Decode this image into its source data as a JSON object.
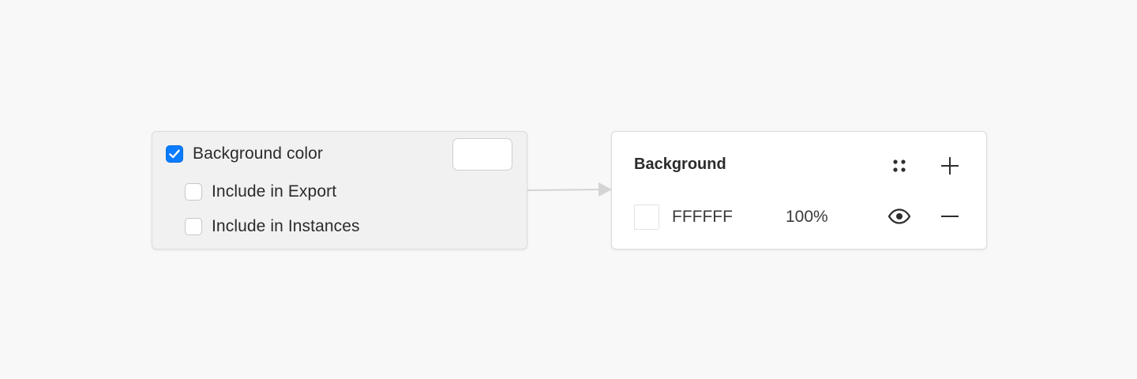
{
  "left_panel": {
    "background_color": {
      "label": "Background color",
      "checked": true,
      "swatch_color": "#FFFFFF"
    },
    "include_in_export": {
      "label": "Include in Export",
      "checked": false
    },
    "include_in_instances": {
      "label": "Include in Instances",
      "checked": false
    }
  },
  "right_panel": {
    "title": "Background",
    "fill": {
      "hex": "FFFFFF",
      "opacity": "100%",
      "swatch_color": "#FFFFFF"
    },
    "icons": {
      "styles": "four-dots-icon",
      "add": "plus-icon",
      "visibility": "eye-icon",
      "remove": "minus-icon"
    }
  },
  "colors": {
    "accent": "#0A7CFF",
    "canvas_background": "#F8F8F8",
    "left_panel_background": "#F1F1F1",
    "right_panel_background": "#FFFFFF",
    "connector": "#D4D4D4"
  }
}
